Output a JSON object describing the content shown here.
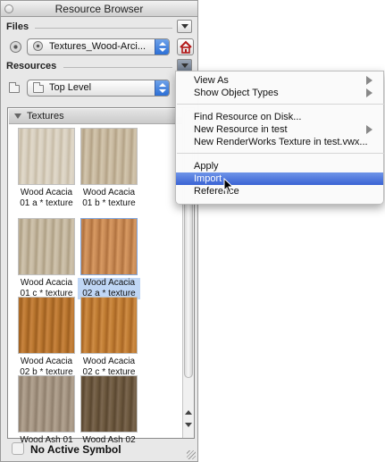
{
  "window": {
    "title": "Resource Browser"
  },
  "files": {
    "label": "Files",
    "file_popup_value": "Textures_Wood-Arci..."
  },
  "resources": {
    "label": "Resources",
    "folder_popup_value": "Top Level"
  },
  "browser": {
    "group_label": "Textures",
    "items": [
      {
        "line1": "Wood Acacia",
        "line2": "01 a * texture",
        "swatch": [
          "#d9d1c2",
          "#c7bca7",
          "#e1d9ca"
        ],
        "selected": false
      },
      {
        "line1": "Wood Acacia",
        "line2": "01 b * texture",
        "swatch": [
          "#c9baa1",
          "#b3a286",
          "#d3c6ae"
        ],
        "selected": false
      },
      {
        "line1": "Wood Acacia",
        "line2": "01 c * texture",
        "swatch": [
          "#c6b9a2",
          "#ae9f84",
          "#d0c4ae"
        ],
        "selected": false
      },
      {
        "line1": "Wood Acacia",
        "line2": "02 a * texture",
        "swatch": [
          "#c98b56",
          "#b0723f",
          "#d89a63"
        ],
        "selected": true
      },
      {
        "line1": "Wood Acacia",
        "line2": "02 b * texture",
        "swatch": [
          "#b9762f",
          "#9e5f1f",
          "#c98540"
        ],
        "selected": false
      },
      {
        "line1": "Wood Acacia",
        "line2": "02 c * texture",
        "swatch": [
          "#c07d33",
          "#a86624",
          "#cf8d46"
        ],
        "selected": false
      },
      {
        "line1": "Wood Ash 01",
        "line2": "",
        "swatch": [
          "#a69684",
          "#8f7f6d",
          "#b3a492"
        ],
        "selected": false
      },
      {
        "line1": "Wood Ash 02",
        "line2": "",
        "swatch": [
          "#6e5a40",
          "#5a4730",
          "#7b6750"
        ],
        "selected": false
      }
    ]
  },
  "status": {
    "text": "No Active Symbol"
  },
  "menu": {
    "groups": [
      [
        {
          "label": "View As",
          "submenu": true,
          "highlight": false
        },
        {
          "label": "Show Object Types",
          "submenu": true,
          "highlight": false
        }
      ],
      [
        {
          "label": "Find Resource on Disk...",
          "submenu": false,
          "highlight": false
        },
        {
          "label": "New Resource in test",
          "submenu": true,
          "highlight": false
        },
        {
          "label": "New RenderWorks Texture in test.vwx...",
          "submenu": false,
          "highlight": false
        }
      ],
      [
        {
          "label": "Apply",
          "submenu": false,
          "highlight": false
        },
        {
          "label": "Import",
          "submenu": false,
          "highlight": true
        },
        {
          "label": "Reference",
          "submenu": false,
          "highlight": false
        }
      ]
    ]
  }
}
